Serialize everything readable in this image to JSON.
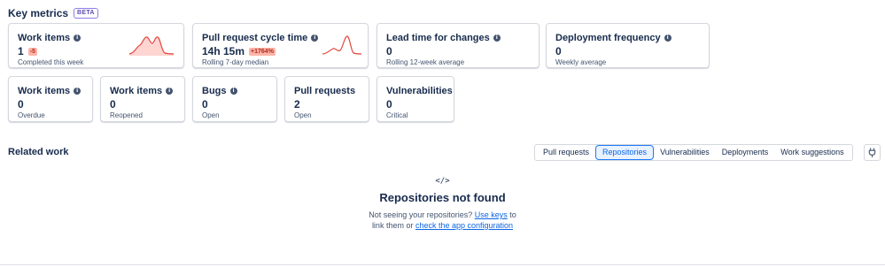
{
  "key_metrics": {
    "title": "Key metrics",
    "badge": "BETA",
    "cards": [
      {
        "title": "Work items",
        "value": "1",
        "delta": "-5",
        "sub": "Completed this week",
        "icon": "info-icon",
        "sparkline": "red-trend"
      },
      {
        "title": "Pull request cycle time",
        "value": "14h 15m",
        "delta": "+1764%",
        "sub": "Rolling 7-day median",
        "icon": "info-icon",
        "sparkline": "red-trend"
      },
      {
        "title": "Lead time for changes",
        "value": "0",
        "sub": "Rolling 12-week average",
        "icon": "info-icon"
      },
      {
        "title": "Deployment frequency",
        "value": "0",
        "sub": "Weekly average",
        "icon": "info-icon"
      },
      {
        "title": "Work items",
        "value": "0",
        "sub": "Overdue",
        "icon": "info-icon"
      },
      {
        "title": "Work items",
        "value": "0",
        "sub": "Reopened",
        "icon": "info-icon"
      },
      {
        "title": "Bugs",
        "value": "0",
        "sub": "Open",
        "icon": "info-icon"
      },
      {
        "title": "Pull requests",
        "value": "2",
        "sub": "Open"
      },
      {
        "title": "Vulnerabilities",
        "value": "0",
        "sub": "Critical"
      }
    ]
  },
  "related_work": {
    "title": "Related work",
    "tabs": [
      "Pull requests",
      "Repositories",
      "Vulnerabilities",
      "Deployments",
      "Work suggestions"
    ],
    "active_tab": "Repositories",
    "plug_icon": "plug-icon"
  },
  "empty_state": {
    "icon": "code-icon",
    "icon_text": "</>",
    "title": "Repositories not found",
    "msg_before": "Not seeing your repositories? ",
    "link1": "Use keys",
    "msg_middle": " to link them or ",
    "link2": "check the app configuration"
  },
  "colors": {
    "accent": "#0c66e4",
    "spark_red": "#e2483d",
    "spark_fill": "#ffd5d2",
    "delta_bg": "#ffb4a8"
  }
}
